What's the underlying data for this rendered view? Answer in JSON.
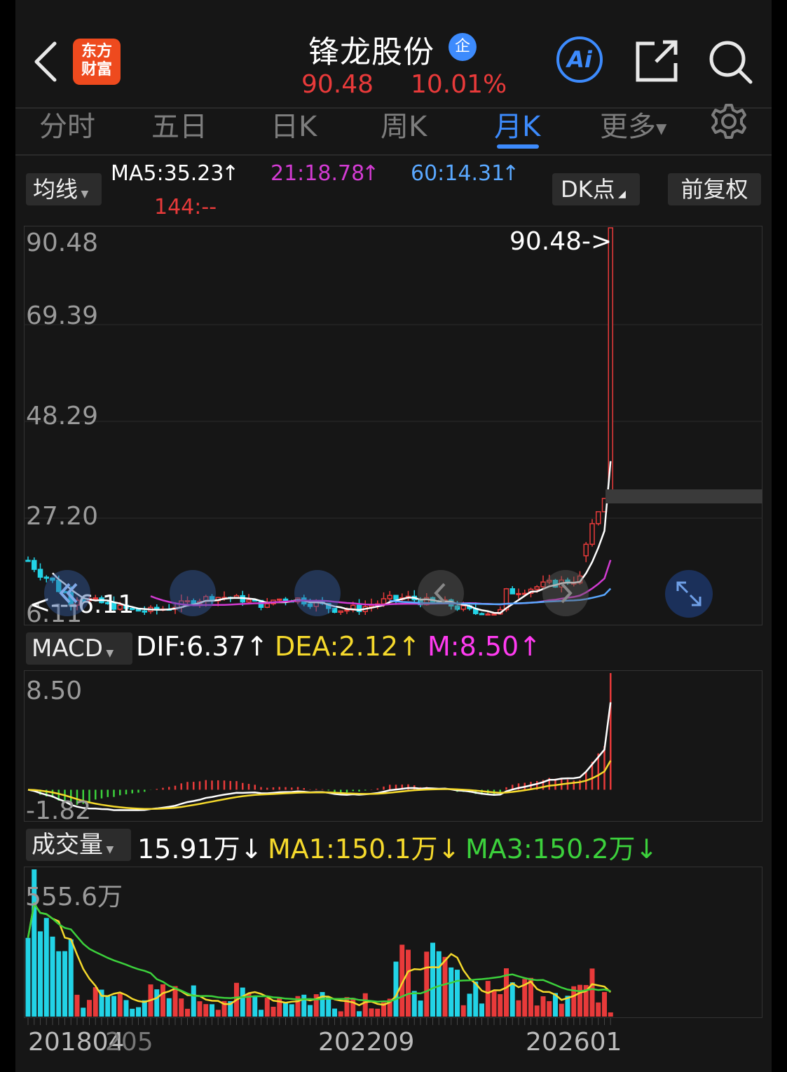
{
  "header": {
    "back_icon": "chevron-left-icon",
    "logo_line1": "东方",
    "logo_line2": "财富",
    "stock_name": "锋龙股份",
    "badge": "企",
    "price": "90.48",
    "change_pct": "10.01%",
    "ai_label": "Ai",
    "share_icon": "share-icon",
    "search_icon": "search-icon"
  },
  "tabs": [
    {
      "label": "分时"
    },
    {
      "label": "五日"
    },
    {
      "label": "日K"
    },
    {
      "label": "周K"
    },
    {
      "label": "月K"
    },
    {
      "label": "更多"
    }
  ],
  "settings_icon": "gear-icon",
  "ma_bar": {
    "dropdown": "均线",
    "ma5": "MA5:35.23",
    "ma21": "21:18.78",
    "ma60": "60:14.31",
    "ma144": "144:--",
    "dk": "DK点",
    "fq": "前复权"
  },
  "colors": {
    "up": "#e83a3a",
    "down": "#22d3e6",
    "ma5": "#ffffff",
    "ma21": "#d23bd2",
    "ma60": "#5aa8ff",
    "dea": "#f5d92c",
    "macd_m": "#ff3bf0",
    "ma3": "#3cd13c",
    "accent": "#3d8bfd"
  },
  "macd_bar": {
    "dropdown": "MACD",
    "dif": "DIF:6.37",
    "dea": "DEA:2.12",
    "m": "M:8.50"
  },
  "vol_bar": {
    "dropdown": "成交量",
    "vol": "15.91万",
    "ma1": "MA1:150.1万",
    "ma3": "MA3:150.2万"
  },
  "chart_data": [
    {
      "type": "candlestick",
      "title": "月K",
      "ylim": [
        6.11,
        90.48
      ],
      "y_ticks": [
        "90.48",
        "69.39",
        "48.29",
        "27.20",
        "6.11"
      ],
      "annotations": [
        "90.48->",
        "<---6.11"
      ],
      "ohlc_recent": [
        {
          "open": 19.0,
          "high": 22.0,
          "low": 17.6,
          "close": 21.5
        },
        {
          "open": 21.5,
          "high": 27.0,
          "low": 21.0,
          "close": 26.0
        },
        {
          "open": 26.0,
          "high": 28.6,
          "low": 25.6,
          "close": 28.6
        },
        {
          "open": 28.6,
          "high": 31.5,
          "low": 28.6,
          "close": 31.5
        },
        {
          "open": 31.5,
          "high": 90.48,
          "low": 31.5,
          "close": 90.48
        }
      ]
    },
    {
      "type": "macd",
      "ylim": [
        -1.82,
        8.5
      ],
      "y_ticks": [
        "8.50",
        "-1.82"
      ],
      "last": {
        "dif": 6.37,
        "dea": 2.12,
        "m": 8.5
      }
    },
    {
      "type": "bar",
      "title": "成交量",
      "ylim": [
        0,
        555.6
      ],
      "y_ticks": [
        "555.6万"
      ],
      "x_ticks": [
        "201804",
        "205",
        "202209",
        "202601"
      ],
      "last": {
        "vol": 15.91,
        "ma1": 150.1,
        "ma3": 150.2
      }
    }
  ]
}
